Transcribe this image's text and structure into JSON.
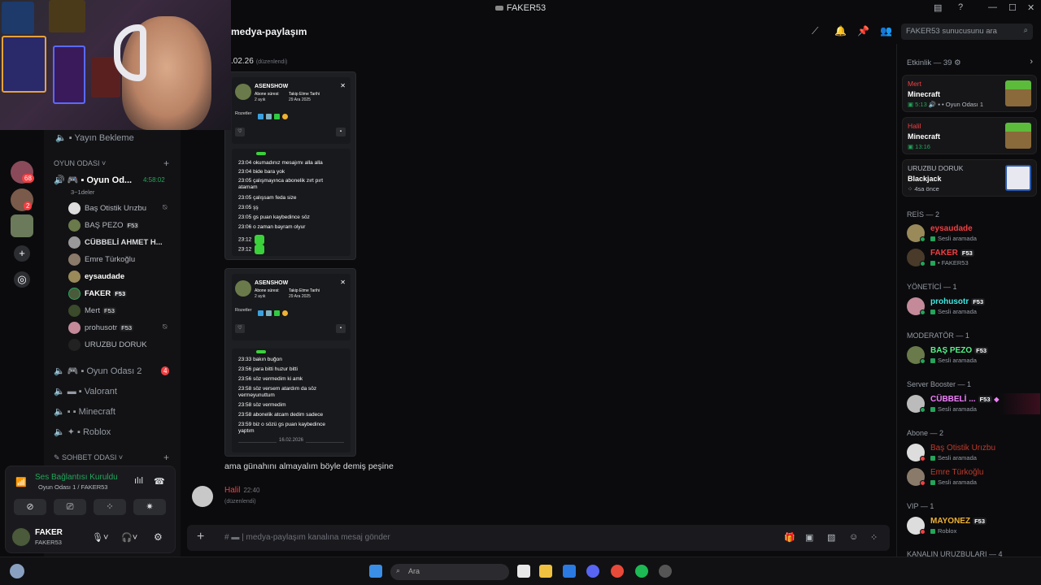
{
  "window": {
    "title": "FAKER53",
    "min": "—",
    "max": "☐",
    "close": "✕"
  },
  "servers": {
    "badge1": "68",
    "badge2": "2"
  },
  "channels": {
    "waiting": "Yayın Bekleme",
    "cat_game": "OYUN ODASI",
    "active_room": "Oyun Od...",
    "active_timer": "4:58:02",
    "active_sub": "3~1deler",
    "voice_members": [
      {
        "name": "Baş Otistik Urızbu",
        "tag": "",
        "color": "#b5bac1"
      },
      {
        "name": "BAŞ PEZO",
        "tag": "F53",
        "color": "#b5bac1"
      },
      {
        "name": "CÜBBELİ AHMET H...",
        "tag": "",
        "color": "#dbdee1"
      },
      {
        "name": "Emre Türkoğlu",
        "tag": "",
        "color": "#b5bac1"
      },
      {
        "name": "eysaudade",
        "tag": "",
        "color": "#ffffff"
      },
      {
        "name": "FAKER",
        "tag": "F53",
        "color": "#ffffff"
      },
      {
        "name": "Mert",
        "tag": "F53",
        "color": "#b5bac1"
      },
      {
        "name": "prohusotr",
        "tag": "F53",
        "color": "#b5bac1"
      },
      {
        "name": "URUZBU DORUK",
        "tag": "",
        "color": "#b5bac1"
      }
    ],
    "room2": "Oyun Odası 2",
    "room2_badge": "4",
    "valorant": "Valorant",
    "minecraft": "Minecraft",
    "roblox": "Roblox",
    "cat_chat": "SOHBET ODASI"
  },
  "voice_panel": {
    "status": "Ses Bağlantısı Kuruldu",
    "location": "Oyun Odası 1 / FAKER53",
    "user": "FAKER",
    "user_sub": "FAKER53"
  },
  "header": {
    "channel": "medya-paylaşım",
    "search_placeholder": "FAKER53 sunucusunu ara"
  },
  "chat": {
    "date_fragment": ".02.26",
    "edited_tag": "(düzenlendi)",
    "profile_name": "ASENSHOW",
    "sub_label": "Abone süresi:",
    "sub_value": "2 ayık",
    "follow_label": "Takip Etme Tarihi",
    "follow_value": "29 Ara 2025",
    "badges_label": "Rozetler",
    "lines1": [
      "23:04 okumadınız mesajımı alla alla",
      "23:04 bide bara yok",
      "23:05 çalışmayınca abonelik zırt pırt atamam",
      "23:05 çalışsam feda size",
      "23:05 şş",
      "23:05 gs puan kaybedince söz",
      "23:06 o zaman bayram olyur",
      "23:12",
      "23:12"
    ],
    "lines2": [
      "23:33 bakın buğon",
      "23:56 para bitti huzur bitti",
      "23:56 söz vermedim ki amk",
      "23:58 söz versem atardım da söz vermeyunuttum",
      "23:58 söz vermedim",
      "23:58 abonelik atcam dedim sadece",
      "23:59 biz o sözü gs puan kaybedince yaptım"
    ],
    "date_divider": "16.02.2026",
    "message_text": "ama günahını almayalım böyle demiş peşine",
    "author": "Halil",
    "author_time": "22:40",
    "author_edited": "(düzenlendi)",
    "composer_placeholder": "medya-paylaşım kanalına mesaj gönder"
  },
  "members": {
    "activity_header": "Etkinlik — 39",
    "activities": [
      {
        "name": "Mert",
        "game": "Minecraft",
        "time": "5:13",
        "extra": "Oyun Odası 1"
      },
      {
        "name": "Halil",
        "game": "Minecraft",
        "time": "13:16",
        "extra": ""
      },
      {
        "name": "URUZBU DORUK",
        "game": "Blackjack",
        "time": "4sa önce",
        "extra": ""
      }
    ],
    "sections": [
      {
        "title": "REİS — 2",
        "members": [
          {
            "name": "eysaudade",
            "status": "Sesli aramada",
            "color": "#f23f43",
            "tag": ""
          },
          {
            "name": "FAKER",
            "status": "FAKER53",
            "color": "#f23f43",
            "tag": "F53"
          }
        ]
      },
      {
        "title": "YÖNETİCİ — 1",
        "members": [
          {
            "name": "prohusotr",
            "status": "Sesli aramada",
            "color": "#3ee8e0",
            "tag": "F53"
          }
        ]
      },
      {
        "title": "MODERATÖR — 1",
        "members": [
          {
            "name": "BAŞ PEZO",
            "status": "Sesli aramada",
            "color": "#57f287",
            "tag": "F53"
          }
        ]
      },
      {
        "title": "Server Booster — 1",
        "members": [
          {
            "name": "CÜBBELİ ...",
            "status": "Sesli aramada",
            "color": "#f47fff",
            "tag": "F53"
          }
        ]
      },
      {
        "title": "Abone — 2",
        "members": [
          {
            "name": "Baş Otistik Urızbu",
            "status": "Sesli aramada",
            "color": "#c0392b",
            "tag": ""
          },
          {
            "name": "Emre Türkoğlu",
            "status": "Sesli aramada",
            "color": "#c0392b",
            "tag": ""
          }
        ]
      },
      {
        "title": "VIP — 1",
        "members": [
          {
            "name": "MAYONEZ",
            "status": "Roblox",
            "color": "#f0b232",
            "tag": "F53"
          }
        ]
      }
    ],
    "last_section": "KANALIN URUZBULARI — 4"
  },
  "taskbar": {
    "search": "Ara"
  }
}
